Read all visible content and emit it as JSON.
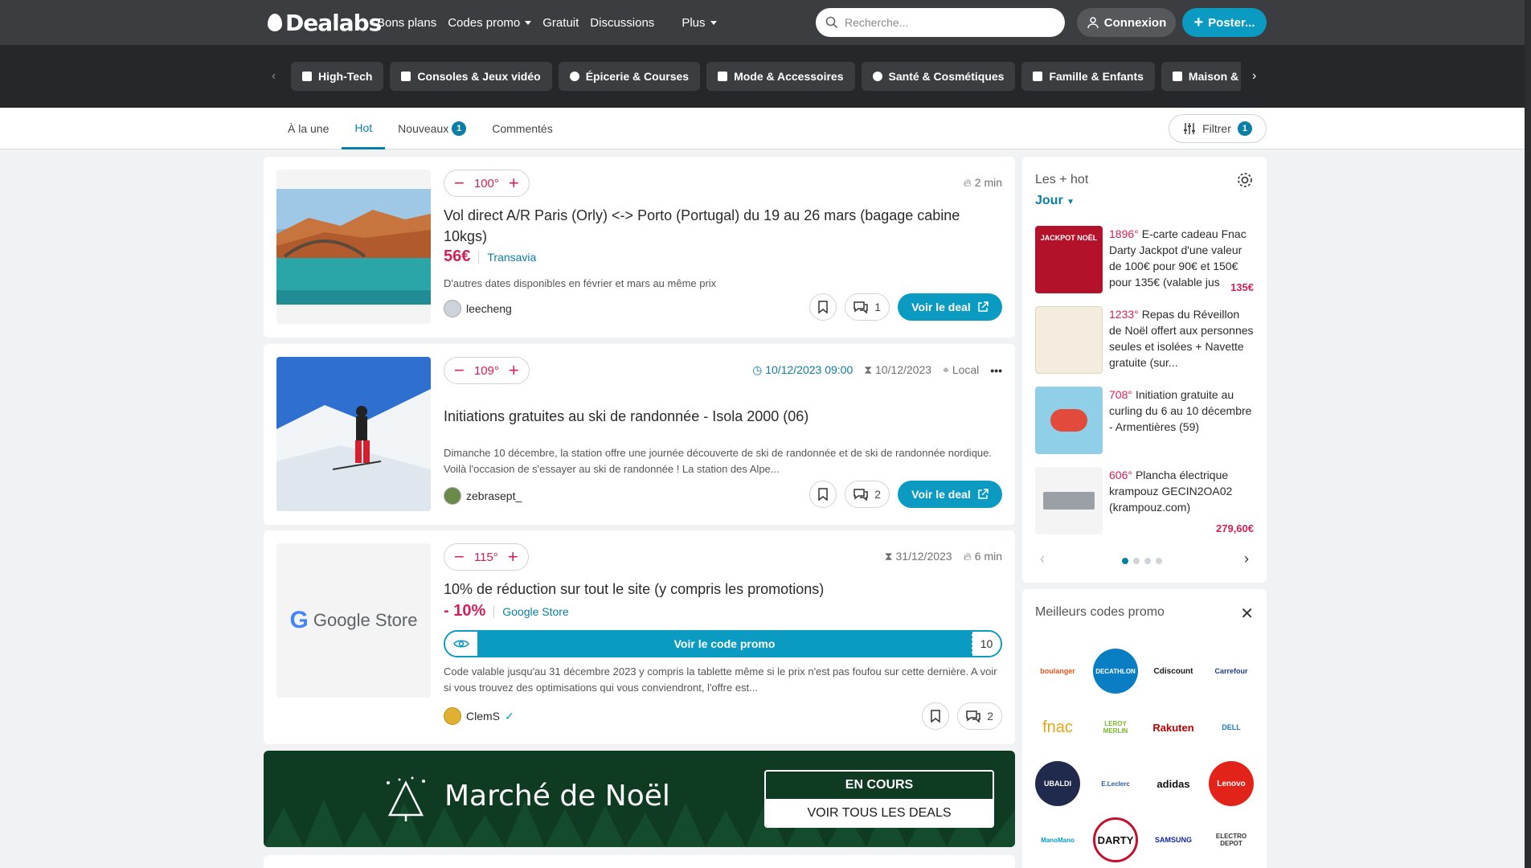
{
  "header": {
    "logo_text": "Dealabs",
    "nav": [
      {
        "label": "Bons plans"
      },
      {
        "label": "Codes promo",
        "dropdown": true
      },
      {
        "label": "Gratuit"
      },
      {
        "label": "Discussions"
      },
      {
        "label": "Plus",
        "dropdown": true
      }
    ],
    "search_placeholder": "Recherche...",
    "login_label": "Connexion",
    "post_label": "Poster..."
  },
  "categories": [
    {
      "label": "High-Tech",
      "icon": "lightning-icon"
    },
    {
      "label": "Consoles & Jeux vidéo",
      "icon": "car-icon"
    },
    {
      "label": "Épicerie & Courses",
      "icon": "apple-icon"
    },
    {
      "label": "Mode & Accessoires",
      "icon": "hanger-icon"
    },
    {
      "label": "Santé & Cosmétiques",
      "icon": "heart-icon"
    },
    {
      "label": "Famille & Enfants",
      "icon": "stroller-icon"
    },
    {
      "label": "Maison & H",
      "icon": "sofa-icon"
    }
  ],
  "tabs": [
    {
      "label": "À la une"
    },
    {
      "label": "Hot",
      "active": true
    },
    {
      "label": "Nouveaux",
      "badge": "1"
    },
    {
      "label": "Commentés"
    }
  ],
  "filter": {
    "label": "Filtrer",
    "badge": "1"
  },
  "deals": [
    {
      "temperature": "100°",
      "meta": {
        "age": "2 min"
      },
      "title": "Vol direct A/R Paris (Orly) <-> Porto (Portugal) du 19 au 26 mars (bagage cabine 10kgs)",
      "price": "56€",
      "merchant": "Transavia",
      "description": "D'autres dates disponibles en février et mars au même prix",
      "user": "leecheng",
      "comments": "1",
      "deal_button": "Voir le deal"
    },
    {
      "temperature": "109°",
      "meta": {
        "start": "10/12/2023 09:00",
        "end": "10/12/2023",
        "location": "Local"
      },
      "title": "Initiations gratuites au ski de randonnée - Isola 2000 (06)",
      "description": "Dimanche 10 décembre, la station offre une journée découverte de ski de randonnée et de ski de randonnée nordique. Voilà l'occasion de s'essayer au ski de randonnée ! La station des Alpe...",
      "user": "zebrasept_",
      "comments": "2",
      "deal_button": "Voir le deal"
    },
    {
      "temperature": "115°",
      "meta": {
        "end": "31/12/2023",
        "age": "6 min"
      },
      "thumb_text": "Google Store",
      "title": "10% de réduction sur tout le site (y compris les promotions)",
      "price": "- 10%",
      "merchant": "Google Store",
      "code_button": "Voir le code promo",
      "code_tail": "10",
      "description": "Code valable jusqu'au 31 décembre 2023 y compris la tablette même si le prix n'est pas foufou sur cette dernière. A voir si vous trouvez des optimisations qui vous conviendront, l'offre est...",
      "user": "ClemS",
      "comments": "2"
    }
  ],
  "banner": {
    "title": "Marché de Noël",
    "status": "EN COURS",
    "cta": "VOIR TOUS LES DEALS"
  },
  "sidebar_hot": {
    "title": "Les + hot",
    "period": "Jour",
    "items": [
      {
        "temp": "1896°",
        "text": "E-carte cadeau Fnac Darty Jackpot d'une valeur de 100€ pour 90€ et 150€ pour 135€ (valable jus",
        "price": "135€",
        "thumb_text": "JACKPOT NOËL"
      },
      {
        "temp": "1233°",
        "text": "Repas du Réveillon de Noël offert aux personnes seules et isolées + Navette gratuite (sur..."
      },
      {
        "temp": "708°",
        "text": "Initiation gratuite au curling du 6 au 10 décembre - Armentières (59)"
      },
      {
        "temp": "606°",
        "text": "Plancha électrique krampouz GECIN2OA02 (krampouz.com)",
        "price": "279,60€"
      }
    ]
  },
  "sidebar_codes": {
    "title": "Meilleurs codes promo",
    "logos": [
      {
        "name": "boulanger",
        "label": "boulanger"
      },
      {
        "name": "decathlon",
        "label": "DECATHLON"
      },
      {
        "name": "cdiscount",
        "label": "Cdiscount"
      },
      {
        "name": "carrefour",
        "label": "Carrefour"
      },
      {
        "name": "fnac",
        "label": "fnac"
      },
      {
        "name": "leroy-merlin",
        "label": "LEROY MERLIN"
      },
      {
        "name": "rakuten",
        "label": "Rakuten"
      },
      {
        "name": "dell",
        "label": "DELL"
      },
      {
        "name": "ubaldi",
        "label": "UBALDI"
      },
      {
        "name": "leclerc",
        "label": "E.Leclerc"
      },
      {
        "name": "adidas",
        "label": "adidas"
      },
      {
        "name": "lenovo",
        "label": "Lenovo"
      },
      {
        "name": "manomano",
        "label": "ManoMano"
      },
      {
        "name": "darty",
        "label": "DARTY"
      },
      {
        "name": "samsung",
        "label": "SAMSUNG"
      },
      {
        "name": "electro-depot",
        "label": "ELECTRO DEPOT"
      }
    ]
  },
  "colors": {
    "accent": "#0a9ac2",
    "hot": "#d0205d",
    "topbar": "#3b3d41",
    "catbar": "#26272a"
  }
}
